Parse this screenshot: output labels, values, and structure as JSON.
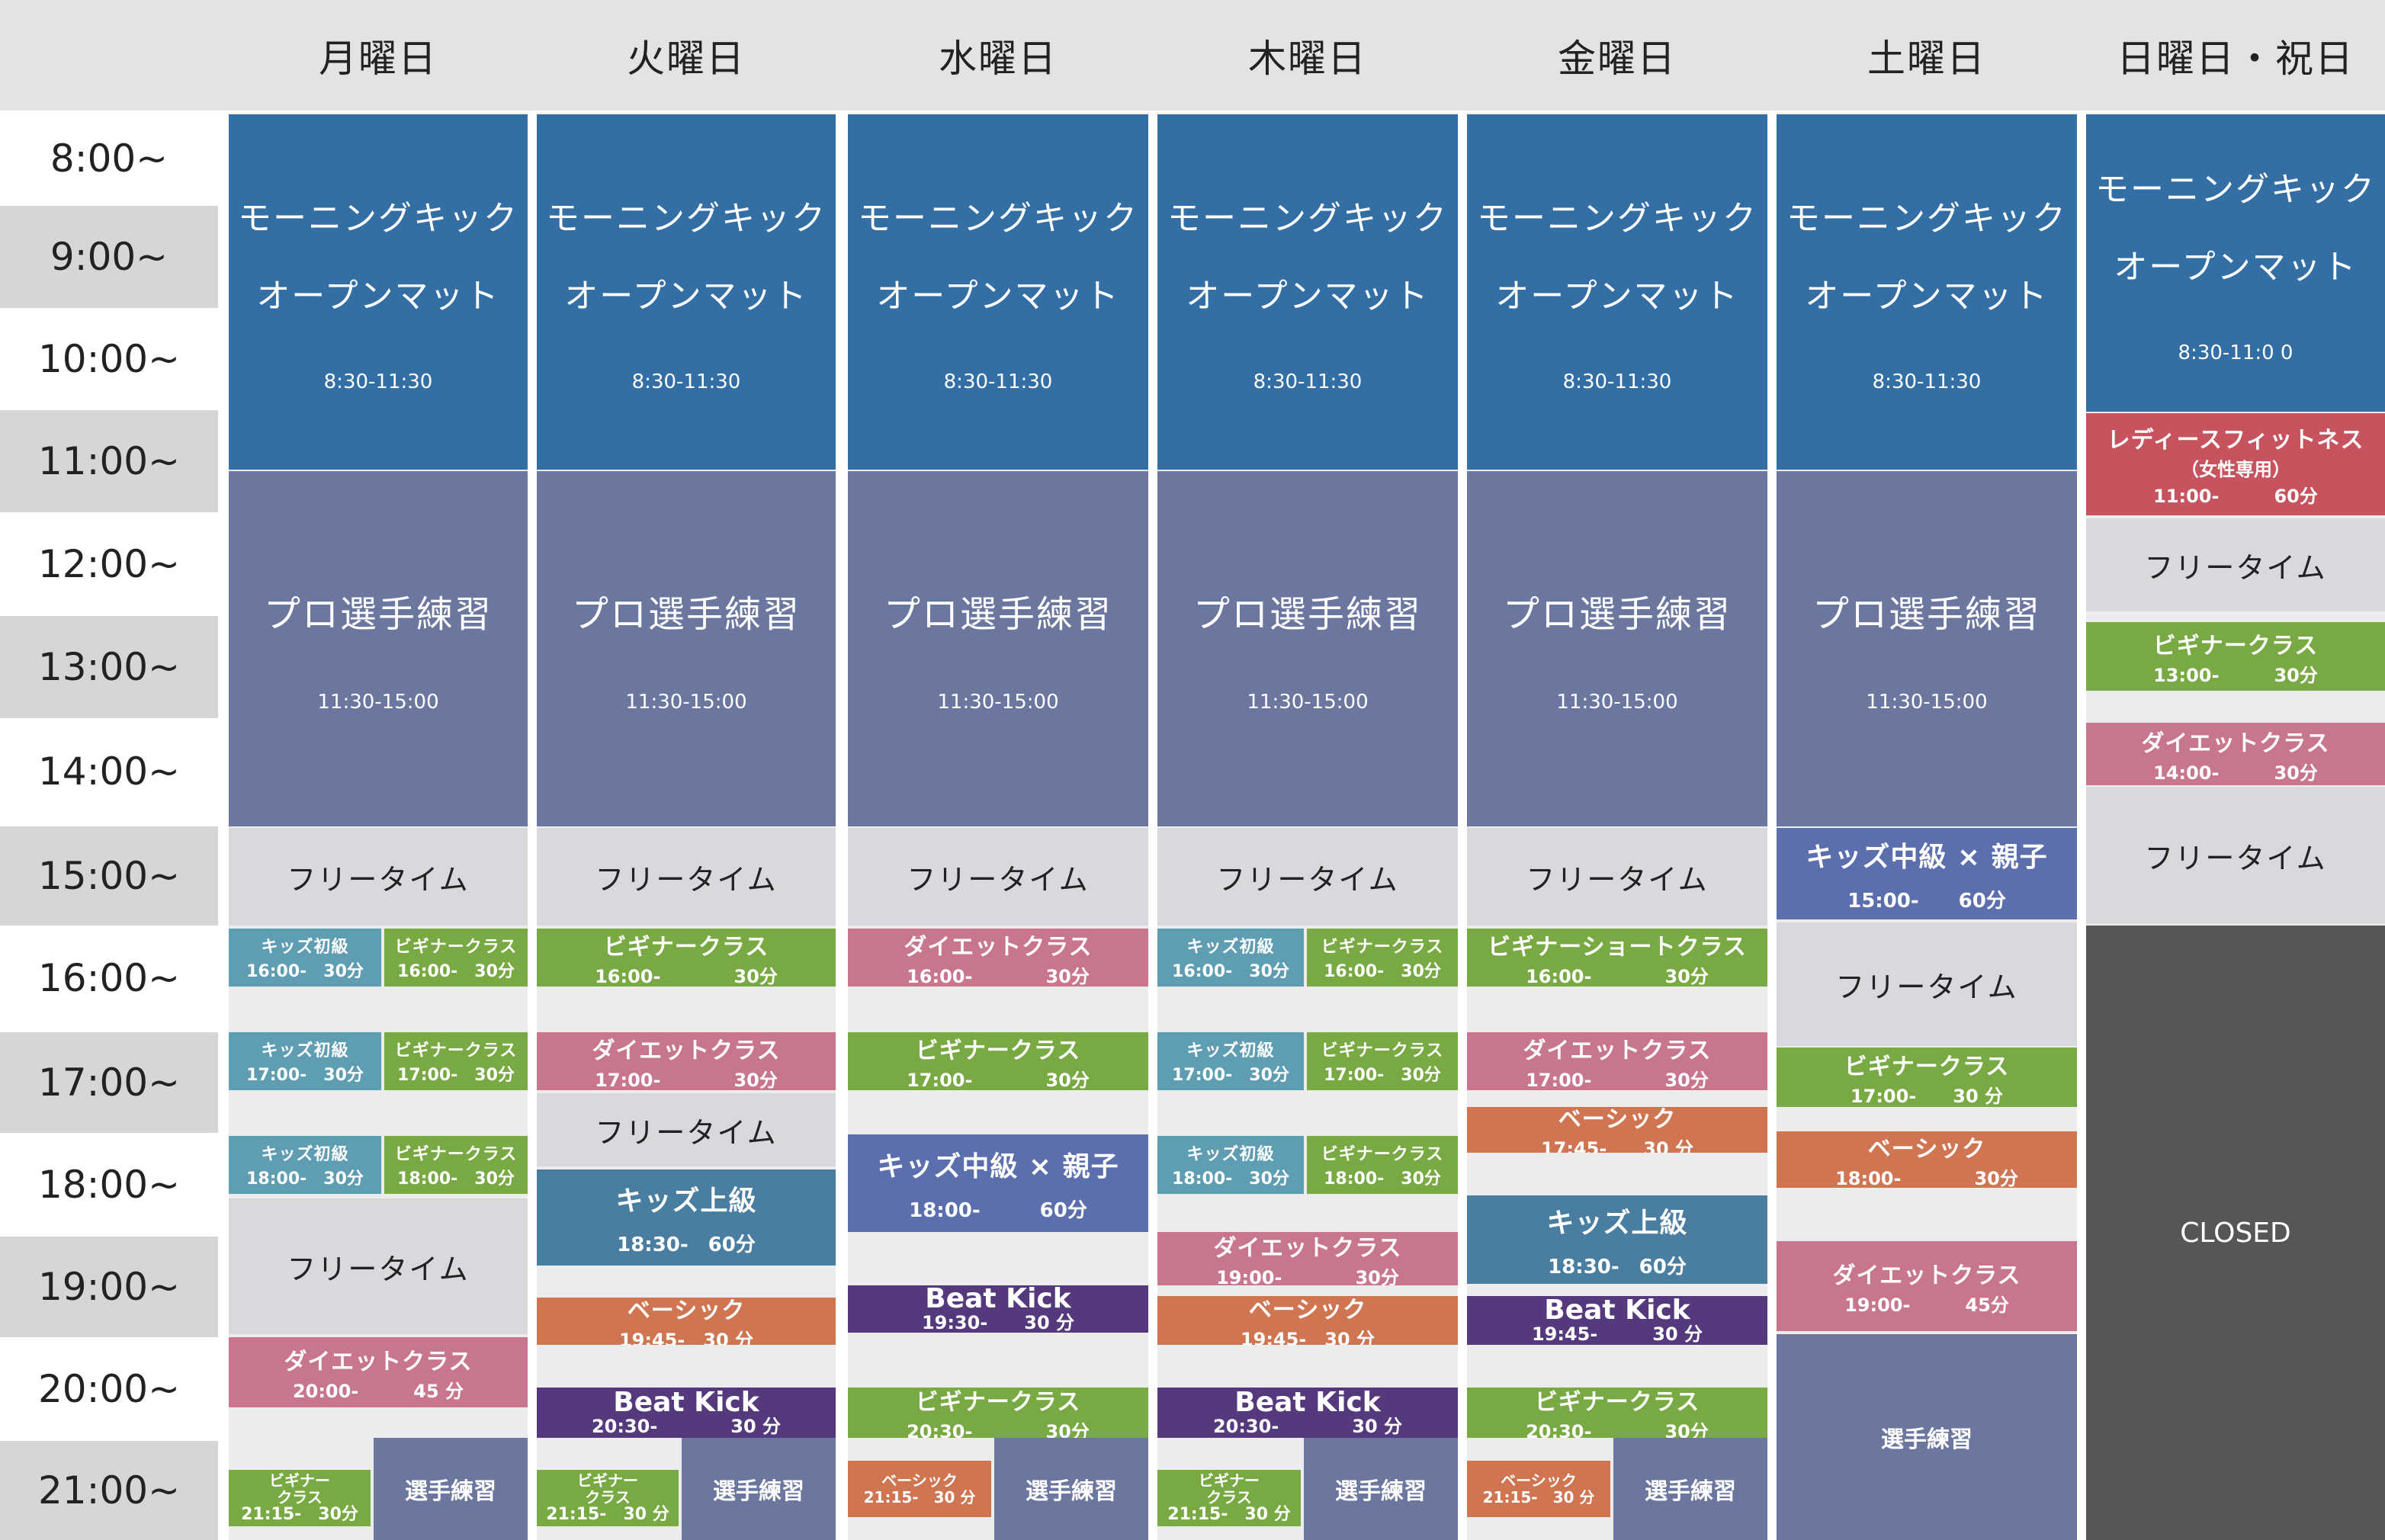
{
  "days": [
    "月曜日",
    "火曜日",
    "水曜日",
    "木曜日",
    "金曜日",
    "土曜日",
    "日曜日・祝日"
  ],
  "times": [
    "8:00~",
    "9:00~",
    "10:00~",
    "11:00~",
    "12:00~",
    "13:00~",
    "14:00~",
    "15:00~",
    "16:00~",
    "17:00~",
    "18:00~",
    "19:00~",
    "20:00~",
    "21:00~"
  ],
  "colors": {
    "morning": "#336ea4",
    "pro": "#6b779f",
    "free": "#d7d9dc",
    "kids_beginner": "#5f9db2",
    "beginner": "#78a943",
    "diet": "#c8768e",
    "basic": "#cf7552",
    "kids_advanced": "#4a7ea0",
    "kids_mid_parent": "#5b6fae",
    "beat_kick": "#54397d",
    "ladies": "#c7535f",
    "closed": "#565656"
  },
  "blocks": [
    {
      "col": 0,
      "t1": "モーニングキック",
      "t2": "オープンマット",
      "t3": "8:30-11:30"
    },
    {
      "col": 0,
      "t1": "プロ選手練習",
      "t3": "11:30-15:00"
    },
    {
      "col": 0,
      "t1": "フリータイム"
    },
    {
      "col": 0,
      "t1": "キッズ初級",
      "t2": "16:00-　30分"
    },
    {
      "col": 0,
      "t1": "ビギナークラス",
      "t2": "16:00-　30分"
    },
    {
      "col": 0,
      "t1": "キッズ初級",
      "t2": "17:00-　30分"
    },
    {
      "col": 0,
      "t1": "ビギナークラス",
      "t2": "17:00-　30分"
    },
    {
      "col": 0,
      "t1": "キッズ初級",
      "t2": "18:00-　30分"
    },
    {
      "col": 0,
      "t1": "ビギナークラス",
      "t2": "18:00-　30分"
    },
    {
      "col": 0,
      "t1": "フリータイム"
    },
    {
      "col": 0,
      "t1": "ダイエットクラス",
      "t2": "20:00-　　　45 分"
    },
    {
      "col": 0,
      "t1": "ビギナー",
      "t2": "クラス",
      "t3": "21:15-　30分"
    },
    {
      "col": 0,
      "t1": "選手練習"
    },
    {
      "col": 1,
      "t1": "モーニングキック",
      "t2": "オープンマット",
      "t3": "8:30-11:30"
    },
    {
      "col": 1,
      "t1": "プロ選手練習",
      "t3": "11:30-15:00"
    },
    {
      "col": 1,
      "t1": "フリータイム"
    },
    {
      "col": 1,
      "t1": "ビギナークラス",
      "t2": "16:00-　　　　30分"
    },
    {
      "col": 1,
      "t1": "ダイエットクラス",
      "t2": "17:00-　　　　30分"
    },
    {
      "col": 1,
      "t1": "フリータイム"
    },
    {
      "col": 1,
      "t1": "キッズ上級",
      "t2": "18:30-　60分"
    },
    {
      "col": 1,
      "t1": "ベーシック",
      "t2": "19:45-　30 分"
    },
    {
      "col": 1,
      "t1": "Beat Kick",
      "t2": "20:30-　　　　30 分"
    },
    {
      "col": 1,
      "t1": "ビギナー",
      "t2": "クラス",
      "t3": "21:15-　30 分"
    },
    {
      "col": 1,
      "t1": "選手練習"
    },
    {
      "col": 2,
      "t1": "モーニングキック",
      "t2": "オープンマット",
      "t3": "8:30-11:30"
    },
    {
      "col": 2,
      "t1": "プロ選手練習",
      "t3": "11:30-15:00"
    },
    {
      "col": 2,
      "t1": "フリータイム"
    },
    {
      "col": 2,
      "t1": "ダイエットクラス",
      "t2": "16:00-　　　　30分"
    },
    {
      "col": 2,
      "t1": "ビギナークラス",
      "t2": "17:00-　　　　30分"
    },
    {
      "col": 2,
      "t1": "キッズ中級 × 親子",
      "t2": "18:00-　　　60分"
    },
    {
      "col": 2,
      "t1": "Beat Kick",
      "t2": "19:30-　　30 分"
    },
    {
      "col": 2,
      "t1": "ビギナークラス",
      "t2": "20:30-　　　　30分"
    },
    {
      "col": 2,
      "t1": "ベーシック",
      "t2": "21:15-　30 分"
    },
    {
      "col": 2,
      "t1": "選手練習"
    },
    {
      "col": 3,
      "t1": "モーニングキック",
      "t2": "オープンマット",
      "t3": "8:30-11:30"
    },
    {
      "col": 3,
      "t1": "プロ選手練習",
      "t3": "11:30-15:00"
    },
    {
      "col": 3,
      "t1": "フリータイム"
    },
    {
      "col": 3,
      "t1": "キッズ初級",
      "t2": "16:00-　30分"
    },
    {
      "col": 3,
      "t1": "ビギナークラス",
      "t2": "16:00-　30分"
    },
    {
      "col": 3,
      "t1": "キッズ初級",
      "t2": "17:00-　30分"
    },
    {
      "col": 3,
      "t1": "ビギナークラス",
      "t2": "17:00-　30分"
    },
    {
      "col": 3,
      "t1": "キッズ初級",
      "t2": "18:00-　30分"
    },
    {
      "col": 3,
      "t1": "ビギナークラス",
      "t2": "18:00-　30分"
    },
    {
      "col": 3,
      "t1": "ダイエットクラス",
      "t2": "19:00-　　　　30分"
    },
    {
      "col": 3,
      "t1": "ベーシック",
      "t2": "19:45-　30 分"
    },
    {
      "col": 3,
      "t1": "Beat Kick",
      "t2": "20:30-　　　　30 分"
    },
    {
      "col": 3,
      "t1": "ビギナー",
      "t2": "クラス",
      "t3": "21:15-　30 分"
    },
    {
      "col": 3,
      "t1": "選手練習"
    },
    {
      "col": 4,
      "t1": "モーニングキック",
      "t2": "オープンマット",
      "t3": "8:30-11:30"
    },
    {
      "col": 4,
      "t1": "プロ選手練習",
      "t3": "11:30-15:00"
    },
    {
      "col": 4,
      "t1": "フリータイム"
    },
    {
      "col": 4,
      "t1": "ビギナーショートクラス",
      "t2": "16:00-　　　　30分"
    },
    {
      "col": 4,
      "t1": "ダイエットクラス",
      "t2": "17:00-　　　　30分"
    },
    {
      "col": 4,
      "t1": "ベーシック",
      "t2": "17:45-　　30 分"
    },
    {
      "col": 4,
      "t1": "キッズ上級",
      "t2": "18:30-　60分"
    },
    {
      "col": 4,
      "t1": "Beat Kick",
      "t2": "19:45-　　　30 分"
    },
    {
      "col": 4,
      "t1": "ビギナークラス",
      "t2": "20:30-　　　　30分"
    },
    {
      "col": 4,
      "t1": "ベーシック",
      "t2": "21:15-　30 分"
    },
    {
      "col": 4,
      "t1": "選手練習"
    },
    {
      "col": 5,
      "t1": "モーニングキック",
      "t2": "オープンマット",
      "t3": "8:30-11:30"
    },
    {
      "col": 5,
      "t1": "プロ選手練習",
      "t3": "11:30-15:00"
    },
    {
      "col": 5,
      "t1": "キッズ中級 × 親子",
      "t2": "15:00-　　60分"
    },
    {
      "col": 5,
      "t1": "フリータイム"
    },
    {
      "col": 5,
      "t1": "ビギナークラス",
      "t2": "17:00-　　30 分"
    },
    {
      "col": 5,
      "t1": "ベーシック",
      "t2": "18:00-　　　　30分"
    },
    {
      "col": 5,
      "t1": "ダイエットクラス",
      "t2": "19:00-　　　45分"
    },
    {
      "col": 5,
      "t1": "選手練習"
    },
    {
      "col": 6,
      "t1": "モーニングキック",
      "t2": "オープンマット",
      "t3": "8:30-11:0 0"
    },
    {
      "col": 6,
      "t1": "レディースフィットネス",
      "t2": "（女性専用）",
      "t3": "11:00-　　　60分"
    },
    {
      "col": 6,
      "t1": "フリータイム"
    },
    {
      "col": 6,
      "t1": "ビギナークラス",
      "t2": "13:00-　　　30分"
    },
    {
      "col": 6,
      "t1": "ダイエットクラス",
      "t2": "14:00-　　　30分"
    },
    {
      "col": 6,
      "t1": "フリータイム"
    },
    {
      "col": 6,
      "t1": "CLOSED"
    }
  ]
}
